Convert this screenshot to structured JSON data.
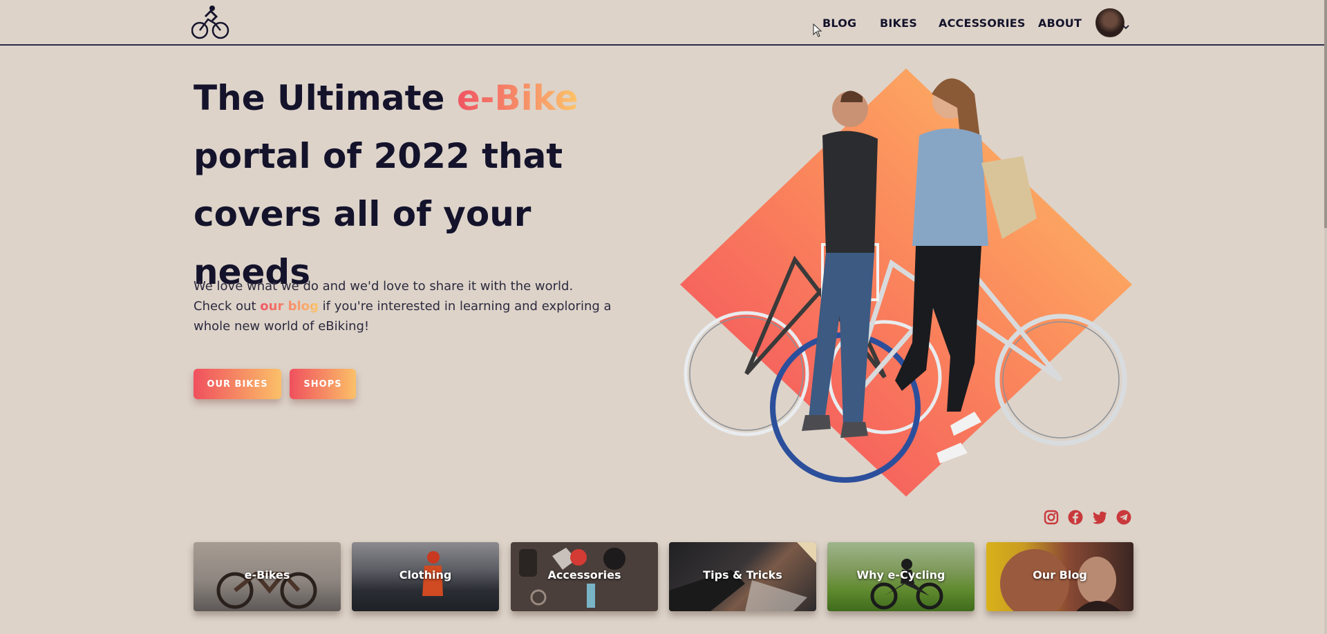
{
  "nav": {
    "items": [
      {
        "label": "BLOG"
      },
      {
        "label": "BIKES"
      },
      {
        "label": "ACCESSORIES"
      },
      {
        "label": "ABOUT"
      }
    ]
  },
  "hero": {
    "title_part1": "The Ultimate ",
    "title_highlight": "e-Bike",
    "title_part2": "portal of 2022 that covers all of your needs",
    "desc_line1": "We love what we do and we'd love to share it with the world.",
    "desc_pre": "Check out ",
    "desc_link": "our blog",
    "desc_post": " if you're interested in learning and exploring a whole new world of eBiking!",
    "btn_bikes": "OUR BIKES",
    "btn_shops": "SHOPS"
  },
  "socials": [
    "instagram-icon",
    "facebook-icon",
    "twitter-icon",
    "telegram-icon"
  ],
  "categories": [
    {
      "label": "e-Bikes"
    },
    {
      "label": "Clothing"
    },
    {
      "label": "Accessories"
    },
    {
      "label": "Tips & Tricks"
    },
    {
      "label": "Why e-Cycling"
    },
    {
      "label": "Our Blog"
    }
  ],
  "colors": {
    "background": "#ddd3c9",
    "text": "#14132b",
    "accent_start": "#f05462",
    "accent_end": "#fcc569",
    "social": "#c9393c"
  }
}
